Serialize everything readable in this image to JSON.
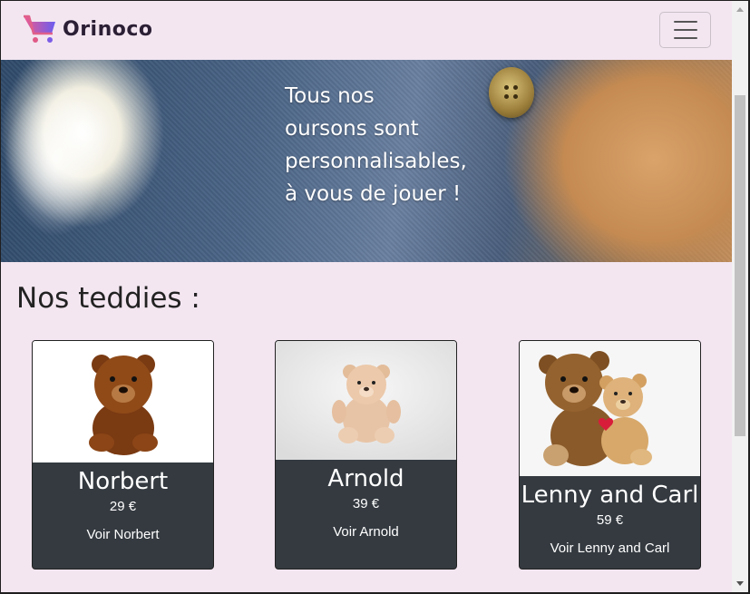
{
  "navbar": {
    "brand": "Orinoco",
    "logo_icon": "shopping-cart-icon",
    "toggler_icon": "hamburger-menu-icon",
    "colors": {
      "cart_from": "#f05a8c",
      "cart_to": "#6a5cf0"
    }
  },
  "hero": {
    "lines": [
      "Tous nos",
      "oursons sont",
      "personnalisables,",
      "à vous de jouer !"
    ]
  },
  "section": {
    "title": "Nos teddies :"
  },
  "products": [
    {
      "name": "Norbert",
      "price": "29 €",
      "link": "Voir Norbert"
    },
    {
      "name": "Arnold",
      "price": "39 €",
      "link": "Voir Arnold"
    },
    {
      "name": "Lenny and Carl",
      "price": "59 €",
      "link": "Voir Lenny and Carl"
    }
  ],
  "colors": {
    "page_bg": "#f3e6f1",
    "card_bg": "#343a40"
  }
}
